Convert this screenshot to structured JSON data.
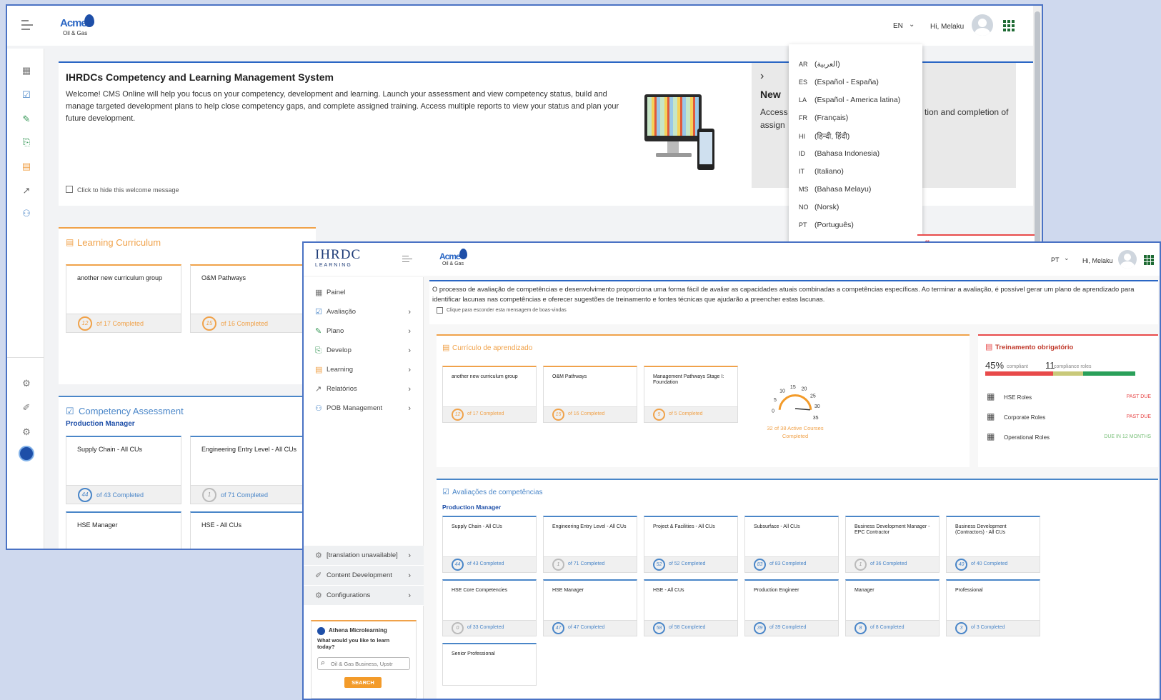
{
  "w1": {
    "brand": {
      "logo_word": "Acme",
      "logo_sub": "Oil & Gas"
    },
    "header": {
      "lang": "EN",
      "greeting": "Hi, Melaku"
    },
    "welcome": {
      "title": "IHRDCs Competency and Learning Management System",
      "body": "Welcome! CMS Online will help you focus on your competency, development and learning. Launch your assessment and view competency status, build and manage targeted development plans to help close competency gaps, and complete assigned training. Access multiple reports to view your status and plan your future development.",
      "hide_label": "Click to hide this welcome message"
    },
    "promo": {
      "title": "New",
      "line1": "Access",
      "line1b": "tion and completion of",
      "line2": "assign"
    },
    "lang_menu": [
      {
        "code": "AR",
        "name": "(العربية)"
      },
      {
        "code": "ES",
        "name": "(Español - España)"
      },
      {
        "code": "LA",
        "name": "(Español - America latina)"
      },
      {
        "code": "FR",
        "name": "(Français)"
      },
      {
        "code": "HI",
        "name": "(हिन्दी, हिंदी)"
      },
      {
        "code": "ID",
        "name": "(Bahasa Indonesia)"
      },
      {
        "code": "IT",
        "name": "(Italiano)"
      },
      {
        "code": "MS",
        "name": "(Bahasa Melayu)"
      },
      {
        "code": "NO",
        "name": "(Norsk)"
      },
      {
        "code": "PT",
        "name": "(Português)"
      }
    ],
    "peek_letter": "g",
    "learning": {
      "title": "Learning Curriculum",
      "cards": [
        {
          "name": "another new curriculum group",
          "done": "12",
          "total": "of 17 Completed"
        },
        {
          "name": "O&M Pathways",
          "done": "15",
          "total": "of 16 Completed"
        }
      ]
    },
    "competency": {
      "title": "Competency Assessment",
      "role": "Production Manager",
      "cards": [
        {
          "name": "Supply Chain - All CUs",
          "done": "44",
          "total": "of 43 Completed"
        },
        {
          "name": "Engineering Entry Level - All CUs",
          "done": "1",
          "total": "of 71 Completed"
        },
        {
          "name": "HSE Manager"
        },
        {
          "name": "HSE - All CUs"
        }
      ]
    }
  },
  "w2": {
    "brand": {
      "ihrdc": "IHRDC",
      "ihrdc_sub": "LEARNING",
      "logo_word": "Acme",
      "logo_sub": "Oil & Gas"
    },
    "header": {
      "lang": "PT",
      "greeting": "Hi, Melaku"
    },
    "menu": [
      {
        "label": "Painel",
        "icon": "dashboard-icon"
      },
      {
        "label": "Avaliação",
        "icon": "assessment-icon"
      },
      {
        "label": "Plano",
        "icon": "plan-icon"
      },
      {
        "label": "Develop",
        "icon": "develop-icon"
      },
      {
        "label": "Learning",
        "icon": "learning-icon"
      },
      {
        "label": "Relatórios",
        "icon": "reports-icon"
      },
      {
        "label": "POB Management",
        "icon": "pob-icon"
      }
    ],
    "menu_bottom": [
      {
        "label": "[translation unavailable]"
      },
      {
        "label": "Content Development"
      },
      {
        "label": "Configurations"
      }
    ],
    "athena": {
      "title": "Athena Microlearning",
      "question": "What would you like to learn today?",
      "placeholder": "Oil & Gas Business, Upstr",
      "button": "SEARCH"
    },
    "welcome": {
      "body": "O processo de avaliação de competências e desenvolvimento proporciona uma forma fácil de avaliar as capacidades atuais combinadas a competências específicas. Ao terminar a avaliação, é possível gerar um plano de aprendizado para identificar lacunas nas competências e oferecer sugestões de treinamento e fontes técnicas que ajudarão a preencher estas lacunas.",
      "hide_label": "Clique para esconder esta mensagem de boas-vindas"
    },
    "learning": {
      "title": "Currículo de aprendizado",
      "cards": [
        {
          "name": "another new curriculum group",
          "done": "12",
          "total": "of 17 Completed"
        },
        {
          "name": "O&M Pathways",
          "done": "15",
          "total": "of 16 Completed"
        },
        {
          "name": "Management Pathways Stage I: Foundation",
          "done": "5",
          "total": "of 5 Completed"
        }
      ],
      "gauge": {
        "ticks": [
          "0",
          "5",
          "10",
          "15",
          "20",
          "25",
          "30",
          "35"
        ],
        "value": 32,
        "label1": "32 of 38 Active Courses",
        "label2": "Completed"
      }
    },
    "mandatory": {
      "title": "Treinamento obrigatório",
      "pct": "45%",
      "pct_label": "compliant",
      "count": "11",
      "count_label": "compliance roles",
      "segments": [
        {
          "value": 45,
          "color": "#e84a4a"
        },
        {
          "value": 20,
          "color": "#c9c97a"
        },
        {
          "value": 35,
          "color": "#2aa05a"
        }
      ],
      "rows": [
        {
          "name": "HSE Roles",
          "status": "PAST DUE",
          "color": "#e84a4a"
        },
        {
          "name": "Corporate Roles",
          "status": "PAST DUE",
          "color": "#e84a4a"
        },
        {
          "name": "Operational Roles",
          "status": "DUE IN 12 MONTHS",
          "color": "#7ac07a"
        }
      ]
    },
    "competency": {
      "title": "Avaliações de competências",
      "role": "Production Manager",
      "cards": [
        {
          "name": "Supply Chain - All CUs",
          "done": "44",
          "total": "of 43 Completed"
        },
        {
          "name": "Engineering Entry Level - All CUs",
          "done": "1",
          "total": "of 71 Completed"
        },
        {
          "name": "Project & Facilities - All CUs",
          "done": "52",
          "total": "of 52 Completed"
        },
        {
          "name": "Subsurface - All CUs",
          "done": "83",
          "total": "of 83 Completed"
        },
        {
          "name": "Business Development Manager - EPC Contractor",
          "done": "1",
          "total": "of 36 Completed"
        },
        {
          "name": "Business Development (Contractors) - All CUs",
          "done": "40",
          "total": "of 40 Completed"
        },
        {
          "name": "HSE Core Competencies",
          "done": "0",
          "total": "of 33 Completed"
        },
        {
          "name": "HSE Manager",
          "done": "47",
          "total": "of 47 Completed"
        },
        {
          "name": "HSE - All CUs",
          "done": "58",
          "total": "of 58 Completed"
        },
        {
          "name": "Production Engineer",
          "done": "39",
          "total": "of 39 Completed"
        },
        {
          "name": "Manager",
          "done": "8",
          "total": "of 8 Completed"
        },
        {
          "name": "Professional",
          "done": "3",
          "total": "of 3 Completed"
        },
        {
          "name": "Senior Professional"
        }
      ]
    }
  }
}
